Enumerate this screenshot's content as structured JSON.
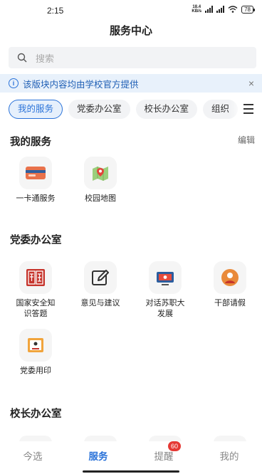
{
  "status": {
    "time": "2:15",
    "net_speed_value": "18.4",
    "net_speed_unit": "KB/s",
    "battery": "78"
  },
  "header": {
    "title": "服务中心"
  },
  "search": {
    "placeholder": "搜索"
  },
  "notice": {
    "text": "该版块内容均由学校官方提供",
    "close": "×"
  },
  "chips": [
    {
      "label": "我的服务"
    },
    {
      "label": "党委办公室"
    },
    {
      "label": "校长办公室"
    },
    {
      "label": "组织"
    }
  ],
  "my_services": {
    "title": "我的服务",
    "edit_label": "编辑",
    "items": [
      {
        "label": "一卡通服务"
      },
      {
        "label": "校园地图"
      }
    ]
  },
  "party_office": {
    "title": "党委办公室",
    "items": [
      {
        "label": "国家安全知识答题"
      },
      {
        "label": "意见与建议"
      },
      {
        "label": "对话苏职大发展"
      },
      {
        "label": "干部请假"
      },
      {
        "label": "党委用印"
      }
    ]
  },
  "president_office": {
    "title": "校长办公室"
  },
  "tabbar": {
    "items": [
      {
        "label": "今选"
      },
      {
        "label": "服务"
      },
      {
        "label": "提醒",
        "badge": "60"
      },
      {
        "label": "我的"
      }
    ]
  },
  "colors": {
    "accent": "#2b73d9",
    "badge": "#e53935",
    "notice_bg": "#e8f1fb"
  }
}
